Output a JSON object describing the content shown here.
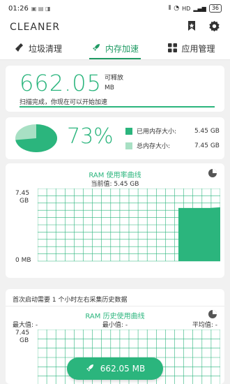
{
  "status": {
    "time": "01:26",
    "signal": "HD",
    "battery": "36"
  },
  "header": {
    "title": "CLEANER"
  },
  "tabs": [
    {
      "label": "垃圾清理",
      "icon": "broom-icon"
    },
    {
      "label": "内存加速",
      "icon": "rocket-icon"
    },
    {
      "label": "应用管理",
      "icon": "apps-grid-icon"
    }
  ],
  "release": {
    "value": "662.05",
    "label": "可释放",
    "unit": "MB",
    "message": "扫描完成，你现在可以开始加速"
  },
  "usage": {
    "percent": "73%",
    "percent_value": 73,
    "used_label": "已用内存大小:",
    "used_value": "5.45 GB",
    "total_label": "总内存大小:",
    "total_value": "7.45 GB"
  },
  "ram_chart": {
    "title": "RAM 使用率曲线",
    "current": "当前值: 5.45 GB",
    "y_top": "7.45\nGB",
    "y_top_num": "7.45",
    "y_top_unit": "GB",
    "y_bottom": "0 MB"
  },
  "history": {
    "note": "首次启动需要 1 个小时左右采集历史数据",
    "title": "RAM 历史使用曲线",
    "max_label": "最大值: -",
    "min_label": "最小值: -",
    "avg_label": "平均值: -",
    "y_top_num": "7.45",
    "y_top_unit": "GB"
  },
  "fab": {
    "label": "662.05 MB"
  },
  "chart_data": {
    "type": "area",
    "title": "RAM 使用率曲线",
    "ylim": [
      0,
      7.45
    ],
    "y_unit": "GB",
    "series": [
      {
        "values": [
          5.45,
          5.45,
          5.45,
          5.45,
          5.45
        ]
      }
    ],
    "grid": true
  },
  "colors": {
    "accent": "#2bb57d",
    "accent_light": "#a8e0c4"
  }
}
